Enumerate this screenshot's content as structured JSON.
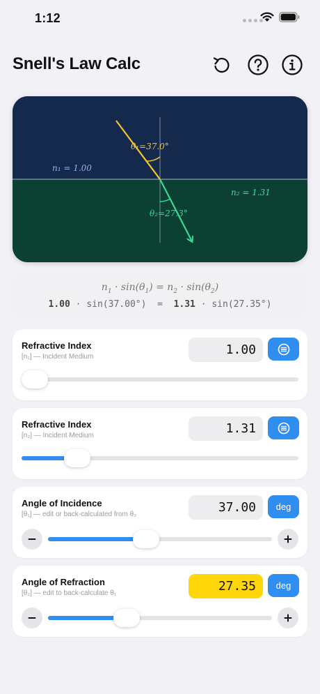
{
  "status": {
    "time": "1:12"
  },
  "header": {
    "title": "Snell's Law Calc",
    "icons": [
      "reset-icon",
      "help-icon",
      "info-icon"
    ]
  },
  "diagram": {
    "n1_label": "n₁ = 1.00",
    "n2_label": "n₂ = 1.31",
    "theta1_label": "θ₁=37.0°",
    "theta2_label": "θ₂=27.3°",
    "colors": {
      "top": "#15294d",
      "bottom": "#0c4032",
      "incident": "#f5c830",
      "refracted": "#38d996"
    }
  },
  "formula": {
    "n1": "1.00",
    "sin1": "sin(37.00°)",
    "eq": "=",
    "n2": "1.31",
    "sin2": "sin(27.35°)"
  },
  "cards": [
    {
      "title": "Refractive Index",
      "subtitle": "[n₁] — Incident Medium",
      "value": "1.00",
      "action": "list-icon",
      "slider": 0.0
    },
    {
      "title": "Refractive Index",
      "subtitle": "[n₂] — Incident Medium",
      "value": "1.31",
      "action": "list-icon",
      "slider": 0.17
    },
    {
      "title": "Angle of Incidence",
      "subtitle": "[θ₁] — edit or back-calculated from θ₂",
      "value": "37.00",
      "action_label": "deg",
      "slider": 0.43
    },
    {
      "title": "Angle of Refraction",
      "subtitle": "[θ₂] — edit to back-calculate θ₁",
      "value": "27.35",
      "action_label": "deg",
      "slider": 0.33,
      "highlight": "#ffd60a"
    }
  ]
}
